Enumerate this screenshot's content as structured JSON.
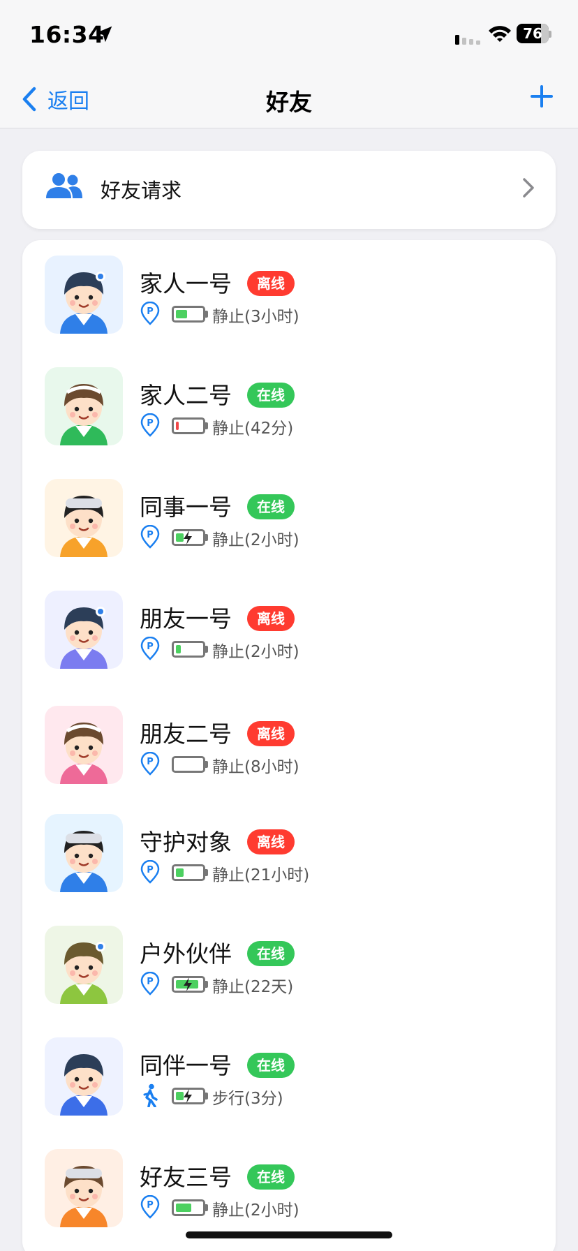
{
  "status_bar": {
    "time": "16:34",
    "battery_text": "76",
    "battery_level": 0.76
  },
  "nav": {
    "back_label": "返回",
    "title": "好友",
    "add_icon": "plus-icon"
  },
  "friend_request": {
    "label": "好友请求",
    "icon": "people-icon"
  },
  "friends": [
    {
      "name": "家人一号",
      "status": "离线",
      "online": false,
      "motion": "静止(3小时)",
      "mode": "parking",
      "battery": 0.45,
      "charging": false,
      "batt_color": "#4cd060",
      "avatar_bg": "#e8f2ff",
      "shirt": "#2f7fe8",
      "hair": "#2c3e58",
      "hat": "dot"
    },
    {
      "name": "家人二号",
      "status": "在线",
      "online": true,
      "motion": "静止(42分)",
      "mode": "parking",
      "battery": 0.12,
      "charging": false,
      "batt_color": "#f04848",
      "avatar_bg": "#e8f8ec",
      "shirt": "#2fba5a",
      "hair": "#6b4a2f",
      "hat": "band"
    },
    {
      "name": "同事一号",
      "status": "在线",
      "online": true,
      "motion": "静止(2小时)",
      "mode": "parking",
      "battery": 0.3,
      "charging": true,
      "batt_color": "#4cd060",
      "avatar_bg": "#fff4e4",
      "shirt": "#f7a22a",
      "hair": "#222",
      "hat": "cap"
    },
    {
      "name": "朋友一号",
      "status": "离线",
      "online": false,
      "motion": "静止(2小时)",
      "mode": "parking",
      "battery": 0.2,
      "charging": false,
      "batt_color": "#4cd060",
      "avatar_bg": "#eef0ff",
      "shirt": "#7b7cf0",
      "hair": "#2c3e58",
      "hat": "dot"
    },
    {
      "name": "朋友二号",
      "status": "离线",
      "online": false,
      "motion": "静止(8小时)",
      "mode": "parking",
      "battery": 0.0,
      "charging": false,
      "batt_color": "#4cd060",
      "avatar_bg": "#ffe8ee",
      "shirt": "#ee6a98",
      "hair": "#6b4a2f",
      "hat": "band"
    },
    {
      "name": "守护对象",
      "status": "离线",
      "online": false,
      "motion": "静止(21小时)",
      "mode": "parking",
      "battery": 0.3,
      "charging": false,
      "batt_color": "#4cd060",
      "avatar_bg": "#e6f4ff",
      "shirt": "#2f7fe8",
      "hair": "#222",
      "hat": "cap"
    },
    {
      "name": "户外伙伴",
      "status": "在线",
      "online": true,
      "motion": "静止(22天)",
      "mode": "parking",
      "battery": 0.9,
      "charging": true,
      "batt_color": "#4cd060",
      "avatar_bg": "#eef6e6",
      "shirt": "#8dc63f",
      "hair": "#6b5a2f",
      "hat": "dot"
    },
    {
      "name": "同伴一号",
      "status": "在线",
      "online": true,
      "motion": "步行(3分)",
      "mode": "walking",
      "battery": 0.3,
      "charging": true,
      "batt_color": "#4cd060",
      "avatar_bg": "#eef2ff",
      "shirt": "#3c6ee8",
      "hair": "#2c3e58",
      "hat": "none"
    },
    {
      "name": "好友三号",
      "status": "在线",
      "online": true,
      "motion": "静止(2小时)",
      "mode": "parking",
      "battery": 0.6,
      "charging": false,
      "batt_color": "#4cd060",
      "avatar_bg": "#ffefe4",
      "shirt": "#f7862a",
      "hair": "#6b4a2f",
      "hat": "cap"
    }
  ],
  "colors": {
    "accent": "#1a7ff0",
    "online": "#34c759",
    "offline": "#ff3b30"
  }
}
